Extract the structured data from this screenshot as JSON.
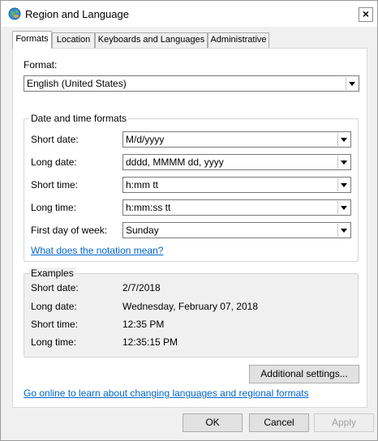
{
  "window": {
    "title": "Region and Language",
    "close_glyph": "×",
    "icon": "globe-icon"
  },
  "tabs": [
    {
      "label": "Formats",
      "active": true
    },
    {
      "label": "Location",
      "active": false
    },
    {
      "label": "Keyboards and Languages",
      "active": false
    },
    {
      "label": "Administrative",
      "active": false
    }
  ],
  "format": {
    "label": "Format:",
    "value": "English (United States)"
  },
  "datetime": {
    "group_title": "Date and time formats",
    "short_date": {
      "label": "Short date:",
      "value": "M/d/yyyy"
    },
    "long_date": {
      "label": "Long date:",
      "value": "dddd, MMMM dd, yyyy"
    },
    "short_time": {
      "label": "Short time:",
      "value": "h:mm tt"
    },
    "long_time": {
      "label": "Long time:",
      "value": "h:mm:ss tt"
    },
    "first_day": {
      "label": "First day of week:",
      "value": "Sunday"
    },
    "notation_link": "What does the notation mean?"
  },
  "examples": {
    "group_title": "Examples",
    "rows": [
      {
        "label": "Short date:",
        "value": "2/7/2018"
      },
      {
        "label": "Long date:",
        "value": "Wednesday, February 07, 2018"
      },
      {
        "label": "Short time:",
        "value": "12:35 PM"
      },
      {
        "label": "Long time:",
        "value": "12:35:15 PM"
      }
    ]
  },
  "additional_settings": "Additional settings...",
  "online_link": "Go online to learn about changing languages and regional formats",
  "buttons": {
    "ok": "OK",
    "cancel": "Cancel",
    "apply": "Apply"
  },
  "colors": {
    "link": "#0066cc",
    "panel": "#ffffff",
    "chrome": "#f0f0f0"
  }
}
